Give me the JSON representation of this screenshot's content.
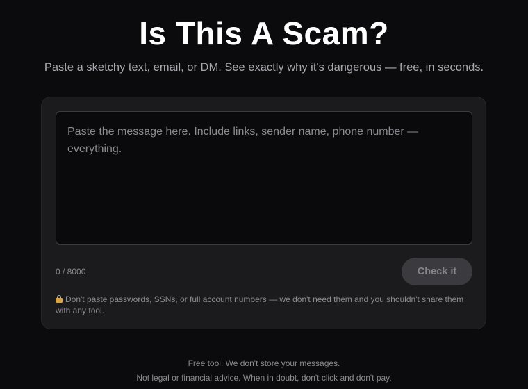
{
  "header": {
    "title": "Is This A Scam?",
    "subtitle": "Paste a sketchy text, email, or DM. See exactly why it's dangerous — free, in seconds."
  },
  "form": {
    "message_placeholder": "Paste the message here. Include links, sender name, phone number — everything.",
    "message_value": "",
    "char_counter": "0 / 8000",
    "submit_label": "Check it",
    "submit_enabled": false,
    "privacy_icon": "lock-icon",
    "privacy_notice": "Don't paste passwords, SSNs, or full account numbers — we don't need them and you shouldn't share them with any tool."
  },
  "footer": {
    "line1": "Free tool. We don't store your messages.",
    "line2": "Not legal or financial advice. When in doubt, don't click and don't pay."
  },
  "colors": {
    "background": "#0b0b0d",
    "card": "#1b1b1e",
    "button_disabled": "#3a3a3f"
  }
}
